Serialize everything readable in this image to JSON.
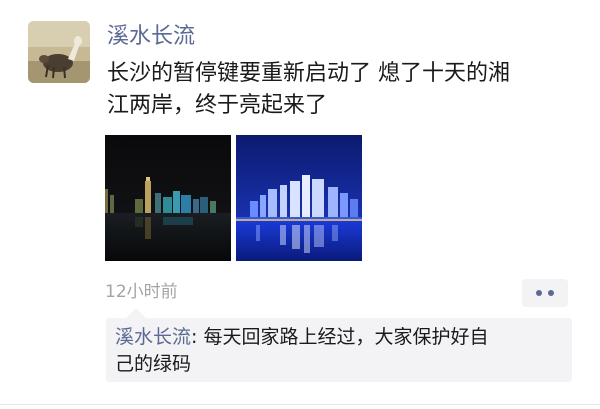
{
  "post": {
    "author": "溪水长流",
    "content_lines": [
      "长沙的暂停键要重新启动了  熄了十天的湘",
      "江两岸，终于亮起来了"
    ],
    "timestamp": "12小时前"
  },
  "comment": {
    "author": "溪水长流",
    "separator": ": ",
    "line1": "每天回家路上经过，大家保护好自",
    "line2": "己的绿码"
  },
  "colors": {
    "name_link": "#5b6a93",
    "text": "#1a1a1a",
    "muted": "#a4a4a4",
    "comment_bg": "#f3f3f5"
  },
  "icons": {
    "more": "more-dots-icon"
  }
}
